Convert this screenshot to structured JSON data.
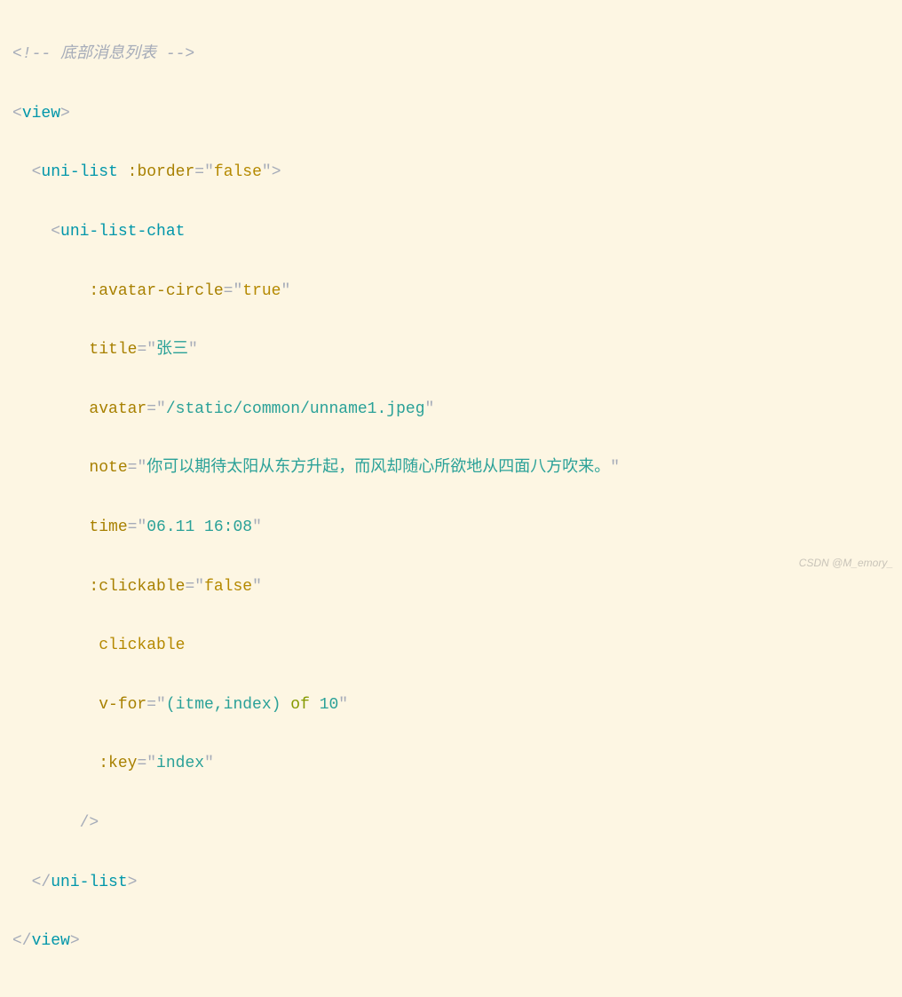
{
  "code": {
    "comment_open": "<!--",
    "comment_text": " 底部消息列表 ",
    "comment_close": "-->",
    "view_open": "view",
    "uni_list": "uni-list",
    "border_attr": ":border",
    "border_val": "false",
    "uni_list_chat": "uni-list-chat",
    "avatar_circle_attr": ":avatar-circle",
    "avatar_circle_val": "true",
    "title_attr": "title",
    "title_val": "张三",
    "avatar_attr": "avatar",
    "avatar_val": "/static/common/unname1.jpeg",
    "note_attr": "note",
    "note_val": "你可以期待太阳从东方升起，而风却随心所欲地从四面八方吹来。",
    "time_attr": "time",
    "time_val": "06.11 16:08",
    "clickable_bind_attr": ":clickable",
    "clickable_bind_val": "false",
    "clickable_bare": "clickable",
    "vfor_attr": "v-for",
    "vfor_val_pre": "(itme,index) ",
    "vfor_of": "of",
    "vfor_val_post": " 10",
    "key_attr": ":key",
    "key_val": "index",
    "self_close": "/>",
    "uni_list_close": "uni-list",
    "view_close": "view"
  },
  "watermark": "CSDN @M_emory_"
}
